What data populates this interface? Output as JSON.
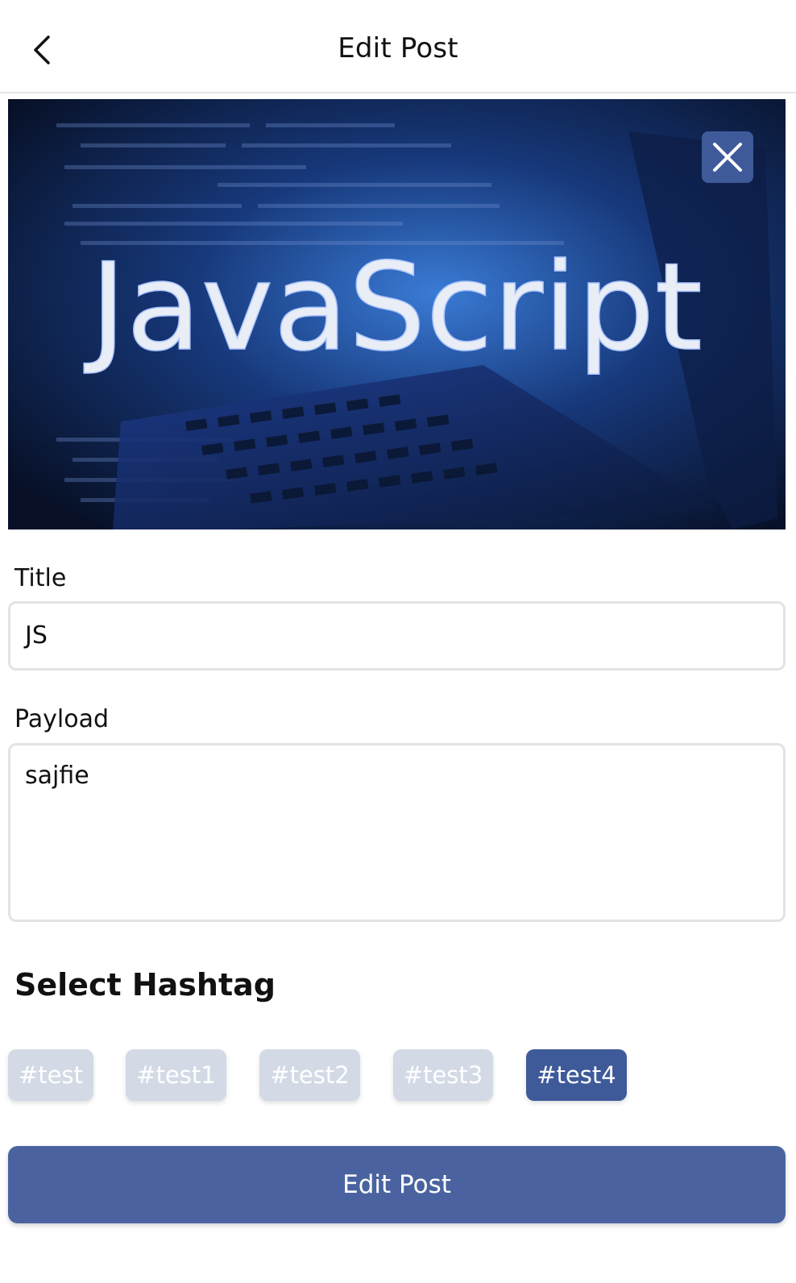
{
  "header": {
    "title": "Edit Post",
    "back_icon": "chevron-left-icon"
  },
  "image": {
    "banner_text": "JavaScript",
    "close_icon": "close-icon"
  },
  "form": {
    "title_label": "Title",
    "title_value": "JS",
    "payload_label": "Payload",
    "payload_value": "sajfie"
  },
  "hashtags": {
    "heading": "Select Hashtag",
    "items": [
      {
        "label": "#test",
        "selected": false
      },
      {
        "label": "#test1",
        "selected": false
      },
      {
        "label": "#test2",
        "selected": false
      },
      {
        "label": "#test3",
        "selected": false
      },
      {
        "label": "#test4",
        "selected": true
      }
    ]
  },
  "submit": {
    "label": "Edit Post"
  },
  "colors": {
    "accent": "#3e5a99",
    "button": "#4a63a0",
    "chip_unselected": "#d3dae6",
    "border": "#e3e3e7"
  }
}
